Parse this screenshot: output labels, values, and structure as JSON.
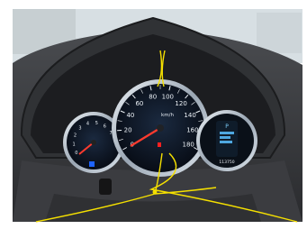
{
  "scene": {
    "description_items": [
      "dashboard-photo"
    ]
  },
  "speedometer": {
    "unit": "km/h",
    "ticks": [
      "0",
      "20",
      "40",
      "60",
      "80",
      "100",
      "120",
      "140",
      "160",
      "180"
    ],
    "needle_value_kmh": 0
  },
  "tachometer": {
    "ticks": [
      "0",
      "1",
      "2",
      "3",
      "4",
      "5",
      "6",
      "7"
    ],
    "needle_value": 0
  },
  "info_display": {
    "odometer": "113750",
    "gear_mark": "P"
  },
  "colors": {
    "bezel": "#2a2a2c",
    "dash": "#3a3b3e",
    "dial_face": "#0b1320",
    "dial_ring": "#b9c4cf",
    "needle": "#ff3b2e",
    "wire": "#f5e000",
    "window": "#dfe6ea"
  }
}
